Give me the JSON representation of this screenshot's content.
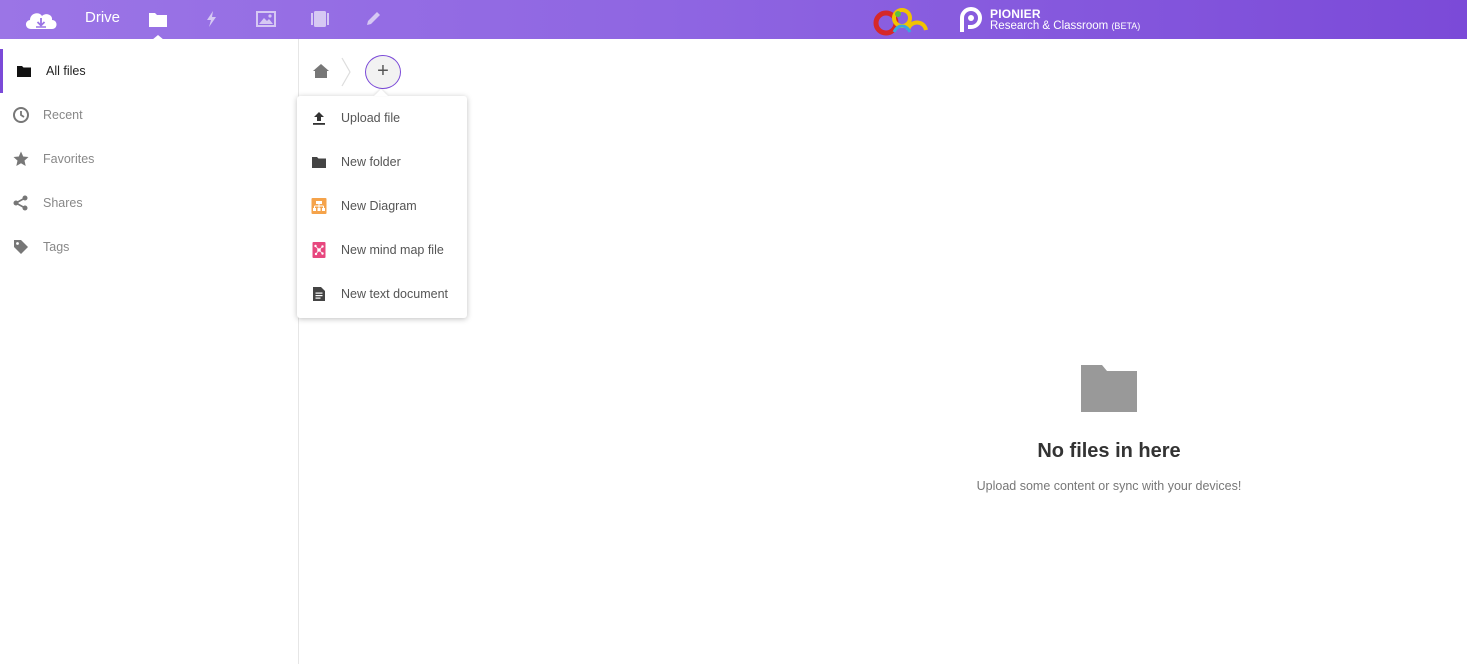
{
  "header": {
    "app_name": "Drive",
    "nav_icons": [
      "files-icon",
      "activity-icon",
      "photos-icon",
      "deck-icon",
      "notes-icon"
    ],
    "brand_name": "PIONIER",
    "brand_subtitle": "Research & Classroom",
    "brand_beta": "(BETA)",
    "colors": {
      "header_start": "#9b75e6",
      "header_end": "#7b4ad8",
      "accent": "#7b4ad8"
    }
  },
  "sidebar": {
    "items": [
      {
        "label": "All files",
        "icon": "folder-icon",
        "active": true
      },
      {
        "label": "Recent",
        "icon": "clock-icon",
        "active": false
      },
      {
        "label": "Favorites",
        "icon": "star-icon",
        "active": false
      },
      {
        "label": "Shares",
        "icon": "share-icon",
        "active": false
      },
      {
        "label": "Tags",
        "icon": "tag-icon",
        "active": false
      }
    ]
  },
  "menu": {
    "items": [
      {
        "label": "Upload file",
        "icon": "upload-icon"
      },
      {
        "label": "New folder",
        "icon": "folder-icon"
      },
      {
        "label": "New Diagram",
        "icon": "diagram-icon"
      },
      {
        "label": "New mind map file",
        "icon": "mindmap-icon"
      },
      {
        "label": "New text document",
        "icon": "text-document-icon"
      }
    ]
  },
  "breadcrumb": {
    "add_symbol": "+"
  },
  "empty": {
    "title": "No files in here",
    "subtitle": "Upload some content or sync with your devices!"
  }
}
